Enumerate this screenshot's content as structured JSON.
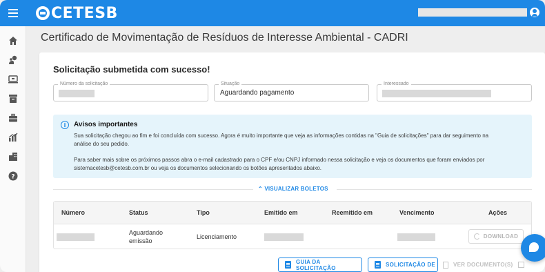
{
  "header": {
    "logo_text": "CETESB",
    "menu_icon": "menu-icon",
    "user_icon": "account-icon"
  },
  "sidebar": {
    "items": [
      {
        "icon": "home-icon"
      },
      {
        "icon": "location-person-icon"
      },
      {
        "icon": "computer-icon"
      },
      {
        "icon": "archive-icon"
      },
      {
        "icon": "briefcase-icon"
      },
      {
        "icon": "chart-icon"
      },
      {
        "icon": "business-icon"
      },
      {
        "icon": "help-icon"
      }
    ]
  },
  "page": {
    "title": "Certificado de Movimentação de Resíduos de Interesse Ambiental - CADRI"
  },
  "card": {
    "success_title": "Solicitação submetida com sucesso!",
    "fields": {
      "numero_label": "Número da solicitação",
      "situacao_label": "Situação",
      "situacao_value": "Aguardando pagamento",
      "interessado_label": "Interessado"
    },
    "info": {
      "title": "Avisos importantes",
      "line1": "Sua solicitação chegou ao fim e foi concluída com sucesso. Agora é muito importante que veja as informações contidas na \"Guia de solicitações\" para dar seguimento na",
      "line2": "análise do seu pedido.",
      "line3": "Para saber mais sobre os próximos passos abra o e-mail cadastrado para o CPF e/ou CNPJ informado nessa solicitação e veja os documentos que foram enviados por",
      "line4": "sistemacetesb@cetesb.com.br ou veja os documentos selecionando os botões apresentados abaixo."
    },
    "boletos_toggle": "VISUALIZAR BOLETOS",
    "table": {
      "headers": [
        "Número",
        "Status",
        "Tipo",
        "Emitido em",
        "Reemitido em",
        "Vencimento",
        "Ações"
      ],
      "row": {
        "status_line1": "Aguardando",
        "status_line2": "emissão",
        "tipo": "Licenciamento",
        "download_label": "DOWNLOAD"
      }
    },
    "actions": {
      "guia": "GUIA DA SOLICITAÇÃO",
      "solicitacao": "SOLICITAÇÃO DE",
      "documentos": "VER DOCUMENTO(S)"
    }
  },
  "colors": {
    "primary": "#1e88e5",
    "info_bg": "#e5f4fb"
  }
}
